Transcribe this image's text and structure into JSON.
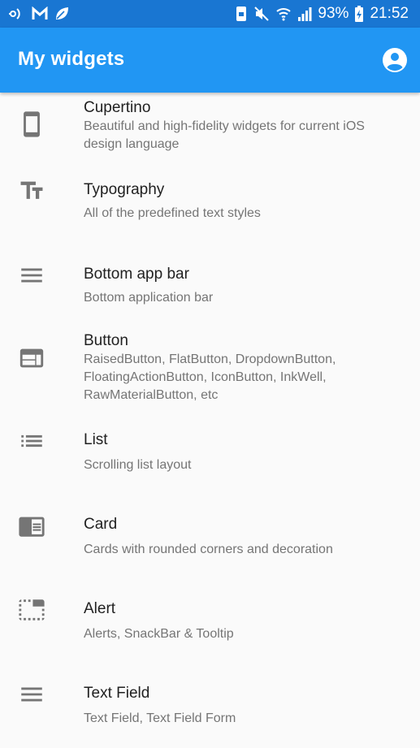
{
  "status_bar": {
    "battery": "93%",
    "time": "21:52"
  },
  "app_bar": {
    "title": "My widgets",
    "account_icon": "account-circle-icon"
  },
  "colors": {
    "status_bar": "#1976d2",
    "app_bar": "#2196f3",
    "title_text": "#212121",
    "subtitle_text": "#757575",
    "icon": "#757575",
    "background": "#fafafa"
  },
  "items": [
    {
      "icon": "smartphone-icon",
      "title": "Cupertino",
      "subtitle": "Beautiful and high-fidelity widgets for current iOS design language"
    },
    {
      "icon": "text-fields-icon",
      "title": "Typography",
      "subtitle": "All of the predefined text styles"
    },
    {
      "icon": "menu-icon",
      "title": "Bottom app bar",
      "subtitle": "Bottom application bar"
    },
    {
      "icon": "web-icon",
      "title": "Button",
      "subtitle": "RaisedButton, FlatButton, DropdownButton, FloatingActionButton, IconButton, InkWell, RawMaterialButton, etc"
    },
    {
      "icon": "list-icon",
      "title": "List",
      "subtitle": "Scrolling list layout"
    },
    {
      "icon": "chrome-reader-mode-icon",
      "title": "Card",
      "subtitle": "Cards with rounded corners and decoration"
    },
    {
      "icon": "tab-unselected-icon",
      "title": "Alert",
      "subtitle": "Alerts, SnackBar & Tooltip"
    },
    {
      "icon": "short-text-icon",
      "title": "Text Field",
      "subtitle": "Text Field, Text Field Form"
    }
  ]
}
